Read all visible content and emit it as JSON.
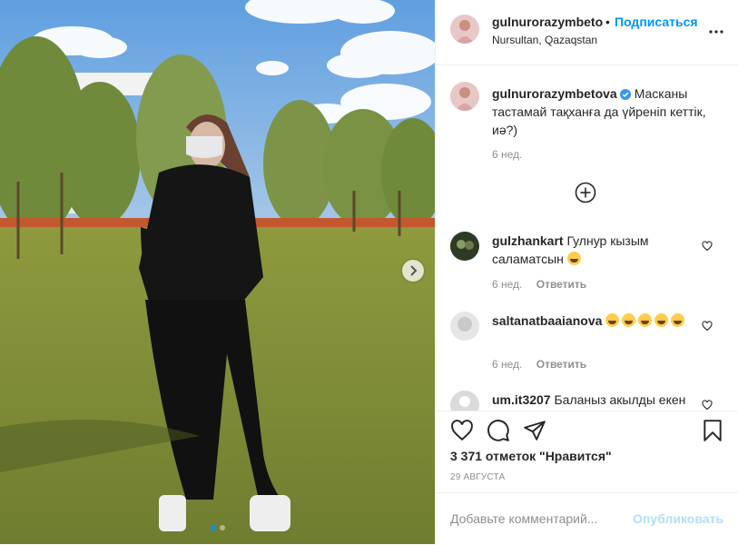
{
  "post": {
    "username": "gulnurorazymbetova",
    "header_username": "gulnurorazymbetov",
    "follow_label": "Подписаться",
    "bullet": "•",
    "location": "Nursultan, Qazaqstan",
    "caption": "Масканы тастамай тақханға да үйреніп кеттік, иә?)",
    "caption_time": "6 нед.",
    "likes_text": "3 371 отметок \"Нравится\"",
    "date_text": "29 АВГУСТА",
    "photo_count": 2,
    "photo_index": 1
  },
  "comments": [
    {
      "username": "gulzhankart",
      "text": "Гулнур кызым саламатсын",
      "emoji_count": 1,
      "time": "6 нед.",
      "reply_label": "Ответить"
    },
    {
      "username": "saltanatbaaianova",
      "text": "",
      "emoji_count": 5,
      "time": "6 нед.",
      "reply_label": "Ответить"
    },
    {
      "username": "um.it3207",
      "text": "Баланыз акылды екен",
      "emoji_count": 0,
      "time": "",
      "reply_label": ""
    }
  ],
  "add_comment": {
    "placeholder": "Добавьте комментарий...",
    "publish_label": "Опубликовать"
  },
  "icons": {
    "more": "more-horizontal-icon",
    "verified": "verified-badge-icon",
    "load_more": "plus-circle-icon",
    "like": "heart-icon",
    "comment": "comment-icon",
    "share": "share-icon",
    "save": "bookmark-icon",
    "next": "chevron-right-icon"
  },
  "colors": {
    "accent": "#0095f6",
    "publish_disabled": "#b2dffc",
    "muted": "#8e8e8e",
    "text": "#262626",
    "divider": "#efefef"
  }
}
